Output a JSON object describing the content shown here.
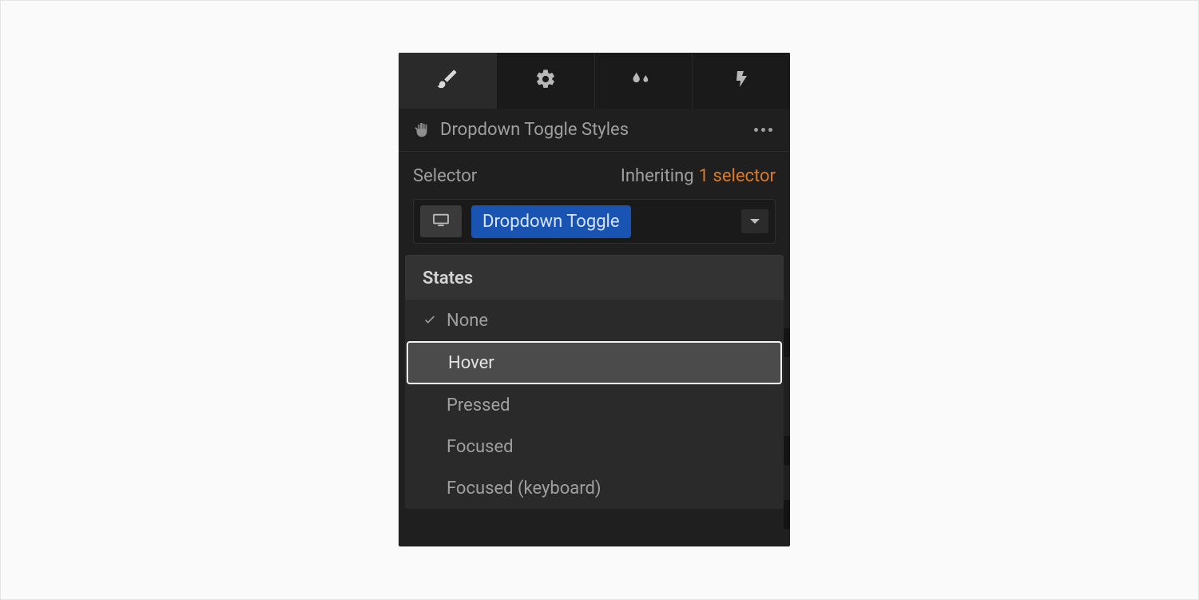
{
  "tabs": {
    "style": "brush-icon",
    "settings": "gear-icon",
    "effects": "droplets-icon",
    "interactions": "bolt-icon",
    "active_index": 0
  },
  "header": {
    "title": "Dropdown Toggle Styles",
    "more_label": "more"
  },
  "selector": {
    "label": "Selector",
    "inheriting_label": "Inheriting",
    "inheriting_count_text": "1 selector",
    "chip": "Dropdown Toggle"
  },
  "states": {
    "header": "States",
    "items": [
      {
        "label": "None",
        "checked": true,
        "highlighted": false
      },
      {
        "label": "Hover",
        "checked": false,
        "highlighted": true
      },
      {
        "label": "Pressed",
        "checked": false,
        "highlighted": false
      },
      {
        "label": "Focused",
        "checked": false,
        "highlighted": false
      },
      {
        "label": "Focused (keyboard)",
        "checked": false,
        "highlighted": false
      }
    ]
  },
  "colors": {
    "panel_bg": "#1f1f1f",
    "chip_bg": "#1a54b3",
    "accent_orange": "#dd7a2a",
    "highlight_bg": "#4b4b4b"
  }
}
